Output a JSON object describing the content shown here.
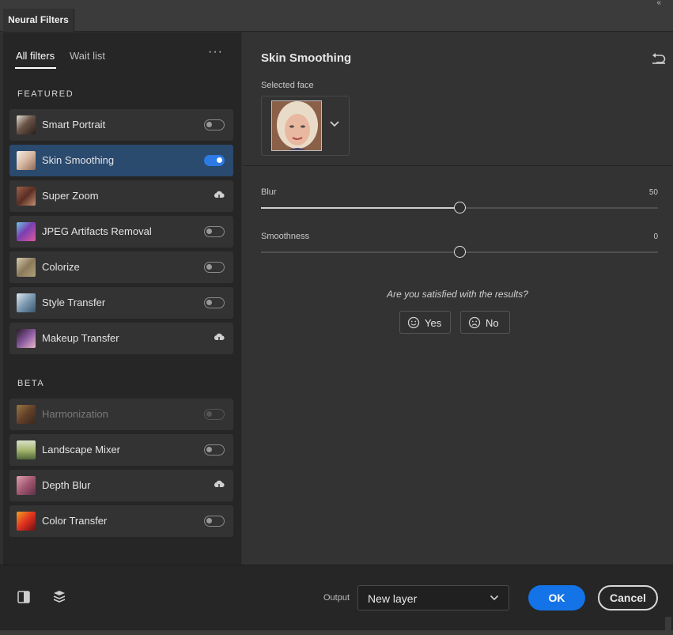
{
  "window": {
    "tab_title": "Neural Filters",
    "collapse_glyph": "‹‹",
    "menu_glyph": "≡"
  },
  "sidebar": {
    "tabs": [
      "All filters",
      "Wait list"
    ],
    "more_glyph": "···",
    "featured_heading": "FEATURED",
    "beta_heading": "BETA",
    "featured": [
      {
        "label": "Smart Portrait",
        "state": "off"
      },
      {
        "label": "Skin Smoothing",
        "state": "on"
      },
      {
        "label": "Super Zoom",
        "state": "download"
      },
      {
        "label": "JPEG Artifacts Removal",
        "state": "off"
      },
      {
        "label": "Colorize",
        "state": "off"
      },
      {
        "label": "Style Transfer",
        "state": "off"
      },
      {
        "label": "Makeup Transfer",
        "state": "download"
      }
    ],
    "beta": [
      {
        "label": "Harmonization",
        "state": "disabled"
      },
      {
        "label": "Landscape Mixer",
        "state": "off"
      },
      {
        "label": "Depth Blur",
        "state": "download"
      },
      {
        "label": "Color Transfer",
        "state": "off"
      }
    ]
  },
  "panel": {
    "title": "Skin Smoothing",
    "selected_face_label": "Selected face",
    "sliders": [
      {
        "label": "Blur",
        "value": "50",
        "fraction": 0.5
      },
      {
        "label": "Smoothness",
        "value": "0",
        "fraction": 0.5
      }
    ],
    "feedback_question": "Are you satisfied with the results?",
    "yes_label": "Yes",
    "no_label": "No"
  },
  "footer": {
    "output_label": "Output",
    "output_value": "New layer",
    "ok_label": "OK",
    "cancel_label": "Cancel"
  },
  "colors": {
    "accent": "#1473e6",
    "selected_row": "#2a4a6e",
    "toggle_on": "#2d7be5"
  }
}
